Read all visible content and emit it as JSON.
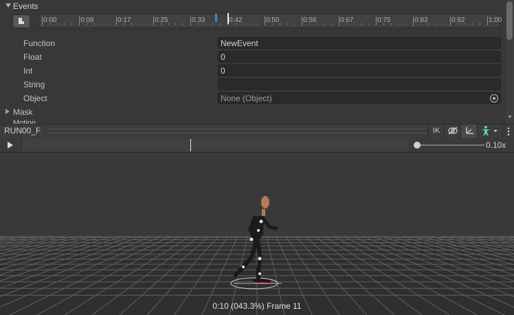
{
  "events": {
    "header_label": "Events",
    "ruler_ticks": [
      "0:00",
      "0:08",
      "0:17",
      "0:25",
      "0:33",
      "0:42",
      "0:50",
      "0:58",
      "0:67",
      "0:75",
      "0:83",
      "0:92",
      "1:00"
    ]
  },
  "properties": [
    {
      "label": "Function",
      "value": "NewEvent"
    },
    {
      "label": "Float",
      "value": "0"
    },
    {
      "label": "Int",
      "value": "0"
    },
    {
      "label": "String",
      "value": ""
    },
    {
      "label": "Object",
      "value": "None (Object)"
    }
  ],
  "sections": {
    "mask": "Mask",
    "motion": "Motion"
  },
  "preview": {
    "clip_name": "RUN00_F",
    "ik_label": "IK",
    "speed_value": "0.10x",
    "status": "0:10 (043.3%) Frame 11"
  },
  "colors": {
    "event_marker": "#4a7fd6",
    "avatar_icon": "#54d0c2",
    "pivot_icon": "#d4d4d4"
  }
}
